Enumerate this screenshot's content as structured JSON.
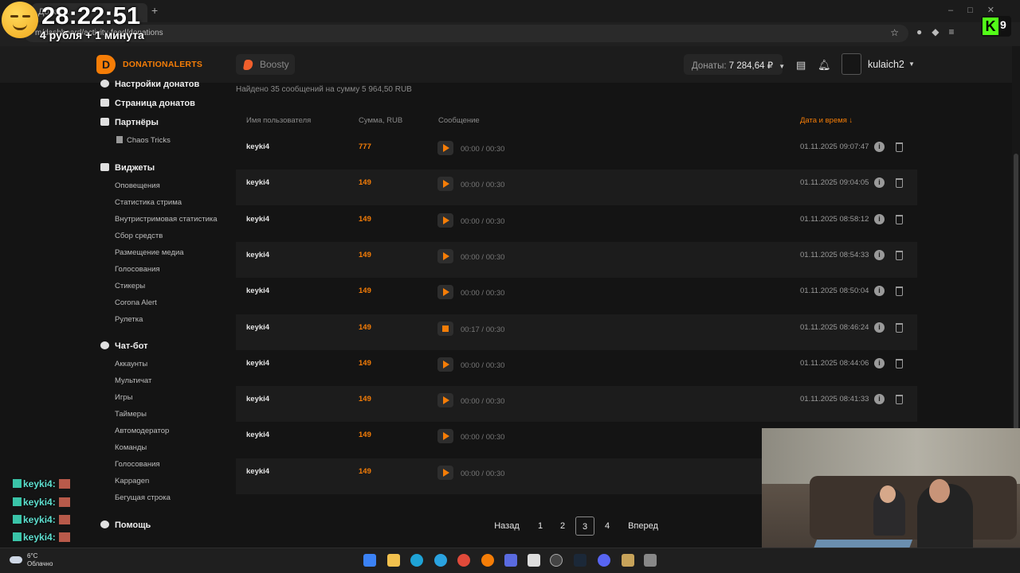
{
  "browser": {
    "tab_title": "Донат...",
    "address": "m/dashboard/activity-feed/donations",
    "new_tab": "+"
  },
  "overlay": {
    "timer": "28:22:51",
    "timer_subtitle": "4 рубля + 1 минута",
    "kick_count": "9",
    "chat": [
      {
        "user": "keyki4:"
      },
      {
        "user": "keyki4:"
      },
      {
        "user": "keyki4:"
      },
      {
        "user": "keyki4:"
      }
    ]
  },
  "header": {
    "brand": "DONATIONALERTS",
    "boosty_label": "Boosty",
    "donats_label": "Донаты:",
    "donats_value": "7 284,64 ₽",
    "username": "kulaich2"
  },
  "sidebar": {
    "sections": [
      {
        "label": "Настройки донатов",
        "items": []
      },
      {
        "label": "Страница донатов",
        "items": []
      },
      {
        "label": "Партнёры",
        "items": [
          "Chaos Tricks"
        ]
      },
      {
        "label": "Виджеты",
        "items": [
          "Оповещения",
          "Статистика стрима",
          "Внутристримовая статистика",
          "Сбор средств",
          "Размещение медиа",
          "Голосования",
          "Стикеры",
          "Corona Alert",
          "Рулетка"
        ]
      },
      {
        "label": "Чат-бот",
        "items": [
          "Аккаунты",
          "Мультичат",
          "Игры",
          "Таймеры",
          "Автомодератор",
          "Команды",
          "Голосования",
          "Kappagen",
          "Бегущая строка"
        ]
      },
      {
        "label": "Помощь",
        "items": []
      }
    ]
  },
  "main": {
    "found_text": "Найдено 35 сообщений на сумму 5 964,50 RUB",
    "columns": {
      "user": "Имя пользователя",
      "sum": "Сумма, RUB",
      "message": "Сообщение",
      "date": "Дата и время ↓"
    },
    "rows": [
      {
        "user": "keyki4",
        "sum": "777",
        "time": "00:00 / 00:30",
        "date": "01.11.2025 09:07:47",
        "state": "play"
      },
      {
        "user": "keyki4",
        "sum": "149",
        "time": "00:00 / 00:30",
        "date": "01.11.2025 09:04:05",
        "state": "play"
      },
      {
        "user": "keyki4",
        "sum": "149",
        "time": "00:00 / 00:30",
        "date": "01.11.2025 08:58:12",
        "state": "play"
      },
      {
        "user": "keyki4",
        "sum": "149",
        "time": "00:00 / 00:30",
        "date": "01.11.2025 08:54:33",
        "state": "play"
      },
      {
        "user": "keyki4",
        "sum": "149",
        "time": "00:00 / 00:30",
        "date": "01.11.2025 08:50:04",
        "state": "play"
      },
      {
        "user": "keyki4",
        "sum": "149",
        "time": "00:17 / 00:30",
        "date": "01.11.2025 08:46:24",
        "state": "stop"
      },
      {
        "user": "keyki4",
        "sum": "149",
        "time": "00:00 / 00:30",
        "date": "01.11.2025 08:44:06",
        "state": "play"
      },
      {
        "user": "keyki4",
        "sum": "149",
        "time": "00:00 / 00:30",
        "date": "01.11.2025 08:41:33",
        "state": "play"
      },
      {
        "user": "keyki4",
        "sum": "149",
        "time": "00:00 / 00:30",
        "date": "",
        "state": "play"
      },
      {
        "user": "keyki4",
        "sum": "149",
        "time": "00:00 / 00:30",
        "date": "",
        "state": "play"
      }
    ],
    "pagination": {
      "prev": "Назад",
      "pages": [
        "1",
        "2",
        "3",
        "4"
      ],
      "active": "3",
      "next": "Вперед"
    }
  },
  "taskbar": {
    "temp": "6°C",
    "weather": "Облачно"
  },
  "colors": {
    "accent": "#f57d07",
    "background": "#141414",
    "row_alt": "#1c1c1c"
  }
}
